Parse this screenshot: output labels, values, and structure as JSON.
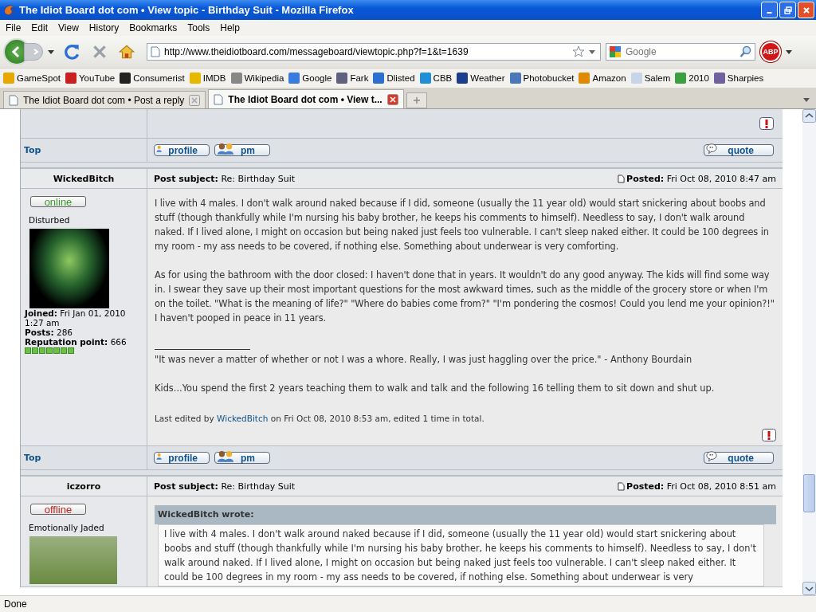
{
  "window": {
    "title": "The Idiot Board dot com • View topic - Birthday Suit - Mozilla Firefox"
  },
  "menu": [
    "File",
    "Edit",
    "View",
    "History",
    "Bookmarks",
    "Tools",
    "Help"
  ],
  "toolbar": {
    "url": "http://www.theidiotboard.com/messageboard/viewtopic.php?f=1&t=1639",
    "search_placeholder": "Google",
    "adblock_label": "ABP"
  },
  "bookmarks": [
    {
      "label": "GameSpot",
      "color": "#e8a800"
    },
    {
      "label": "YouTube",
      "color": "#cc2020"
    },
    {
      "label": "Consumerist",
      "color": "#222222"
    },
    {
      "label": "IMDB",
      "color": "#e6b800"
    },
    {
      "label": "Wikipedia",
      "color": "#888888"
    },
    {
      "label": "Google",
      "color": "#3a7be0"
    },
    {
      "label": "Fark",
      "color": "#606080"
    },
    {
      "label": "Dlisted",
      "color": "#2d6fd0"
    },
    {
      "label": "CBB",
      "color": "#1f8fd8"
    },
    {
      "label": "Weather",
      "color": "#1a3d8f"
    },
    {
      "label": "Photobucket",
      "color": "#4a78b8"
    },
    {
      "label": "Amazon",
      "color": "#e08a00"
    },
    {
      "label": "Salem",
      "color": "#c8d4e8"
    },
    {
      "label": "2010",
      "color": "#3aa040"
    },
    {
      "label": "Sharpies",
      "color": "#7060a0"
    }
  ],
  "tabs": [
    {
      "label": "The Idiot Board dot com • Post a reply",
      "selected": false
    },
    {
      "label": "The Idiot Board dot com • View t...",
      "selected": true
    }
  ],
  "posts": [
    {
      "kind": "tail",
      "footer": {
        "top": "Top",
        "profile": "profile",
        "pm": "pm",
        "quote": "quote"
      }
    },
    {
      "kind": "full",
      "author": "WickedBitch",
      "status": {
        "label": "online",
        "online": true
      },
      "rank": "Disturbed",
      "joined": "**Joined:** Fri Jan 01, 2010 1:27 am",
      "post_count": "**Posts:** 286",
      "reputation": "**Reputation point:** 666",
      "stars": 7,
      "subject": "**Post subject:** Re: Birthday Suit",
      "posted": "**Posted:** Fri Oct 08, 2010 8:47 am",
      "paragraphs": [
        "I live with 4 males. I don't walk around naked because if I did, someone (usually the 11 year old) would start snickering about boobs and stuff (though thankfully while I'm nursing his baby brother, he keeps his comments to himself). Needless to say, I don't walk around naked. If I lived alone, I might on occasion but being naked just feels too vulnerable. I can't sleep naked either. It could be 100 degrees in my room - my ass needs to be covered, if nothing else. Something about underwear is very comforting.",
        "As for using the bathroom with the door closed: I haven't done that in years. It wouldn't do any good anyway. The kids will find some way in. I swear they save up their most important questions for the most awkward times, such as the middle of the grocery store or when I'm on the toilet. \"What is the meaning of life?\" \"Where do babies come from?\" \"I'm pondering the cosmos! Could you lend me your opinion?!\" I haven't pooped in peace in 11 years."
      ],
      "signature": [
        "\"It was never a matter of whether or not I was a whore. Really, I was just haggling over the price.\" - Anthony Bourdain",
        "Kids...You spend the first 2 years teaching them to walk and talk and the following 16 telling them to sit down and shut up."
      ],
      "edited": {
        "before": "Last edited by",
        "user": "WickedBitch",
        "after": "on Fri Oct 08, 2010 8:53 am, edited 1 time in total."
      },
      "footer": {
        "top": "Top",
        "profile": "profile",
        "pm": "pm",
        "quote": "quote"
      }
    },
    {
      "kind": "full",
      "author": "iczorro",
      "status": {
        "label": "offline",
        "online": false
      },
      "rank": "Emotionally Jaded",
      "subject": "**Post subject:** Re: Birthday Suit",
      "posted": "**Posted:** Fri Oct 08, 2010 8:51 am",
      "quote": {
        "heading": "WickedBitch wrote:",
        "text": "I live with 4 males. I don't walk around naked because if I did, someone (usually the 11 year old) would start snickering about boobs and stuff (though thankfully while I'm nursing his baby brother, he keeps his comments to himself). Needless to say, I don't walk around naked. If I lived alone, I might on occasion but being naked just feels too vulnerable. I can't sleep naked either. It could be 100 degrees in my room - my ass needs to be covered, if nothing else. Something about underwear is very"
      }
    }
  ],
  "status_bar": "Done"
}
